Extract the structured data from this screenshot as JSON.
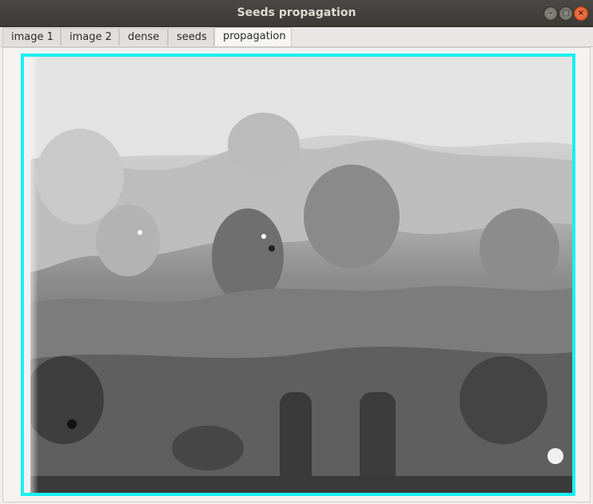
{
  "window": {
    "title": "Seeds propagation"
  },
  "tabs": [
    {
      "label": "image 1",
      "active": false
    },
    {
      "label": "image 2",
      "active": false
    },
    {
      "label": "dense",
      "active": false
    },
    {
      "label": "seeds",
      "active": false
    },
    {
      "label": "propagation",
      "active": true
    }
  ],
  "colors": {
    "frame_border": "#19f0f0",
    "close_button": "#e05a2a"
  }
}
